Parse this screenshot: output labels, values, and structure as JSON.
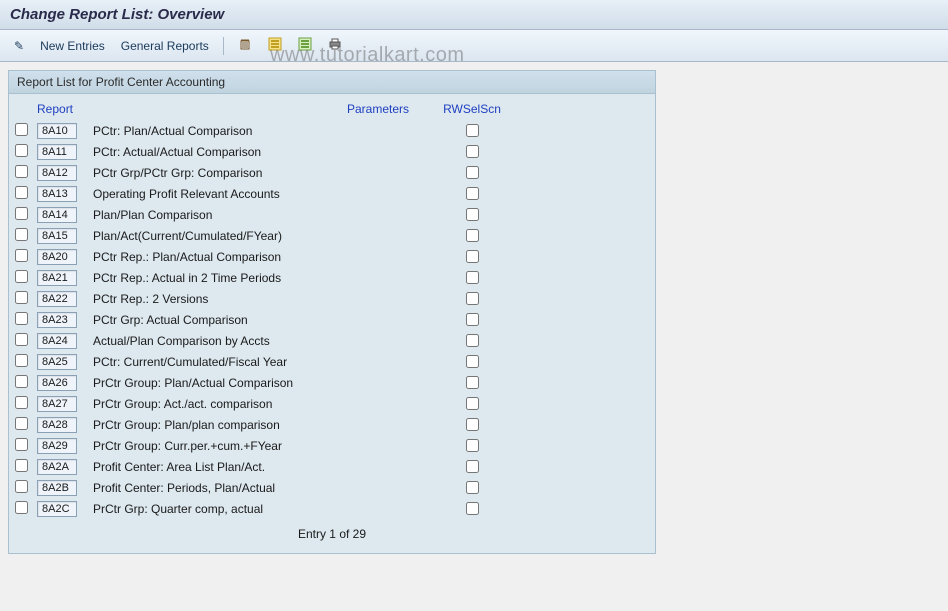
{
  "title": "Change Report List: Overview",
  "toolbar": {
    "tool_icon": "✎",
    "new_entries": "New Entries",
    "general_reports": "General Reports"
  },
  "panel": {
    "header": "Report List for Profit Center Accounting"
  },
  "columns": {
    "report": "Report",
    "parameters": "Parameters",
    "rwselscn": "RWSelScn"
  },
  "rows": [
    {
      "code": "8A10",
      "desc": "PCtr: Plan/Actual Comparison"
    },
    {
      "code": "8A11",
      "desc": "PCtr: Actual/Actual Comparison"
    },
    {
      "code": "8A12",
      "desc": "PCtr Grp/PCtr Grp: Comparison"
    },
    {
      "code": "8A13",
      "desc": "Operating Profit Relevant Accounts"
    },
    {
      "code": "8A14",
      "desc": "Plan/Plan Comparison"
    },
    {
      "code": "8A15",
      "desc": "Plan/Act(Current/Cumulated/FYear)"
    },
    {
      "code": "8A20",
      "desc": "PCtr Rep.: Plan/Actual Comparison"
    },
    {
      "code": "8A21",
      "desc": "PCtr Rep.: Actual in 2 Time Periods"
    },
    {
      "code": "8A22",
      "desc": "PCtr Rep.: 2 Versions"
    },
    {
      "code": "8A23",
      "desc": "PCtr Grp: Actual Comparison"
    },
    {
      "code": "8A24",
      "desc": "Actual/Plan Comparison by Accts"
    },
    {
      "code": "8A25",
      "desc": "PCtr: Current/Cumulated/Fiscal Year"
    },
    {
      "code": "8A26",
      "desc": "PrCtr Group: Plan/Actual Comparison"
    },
    {
      "code": "8A27",
      "desc": "PrCtr Group: Act./act. comparison"
    },
    {
      "code": "8A28",
      "desc": "PrCtr Group: Plan/plan comparison"
    },
    {
      "code": "8A29",
      "desc": "PrCtr Group: Curr.per.+cum.+FYear"
    },
    {
      "code": "8A2A",
      "desc": "Profit Center: Area List Plan/Act."
    },
    {
      "code": "8A2B",
      "desc": "Profit Center: Periods, Plan/Actual"
    },
    {
      "code": "8A2C",
      "desc": "PrCtr Grp: Quarter comp, actual"
    }
  ],
  "footer": {
    "entry_text": "Entry 1 of 29"
  },
  "watermark": "www.tutorialkart.com"
}
